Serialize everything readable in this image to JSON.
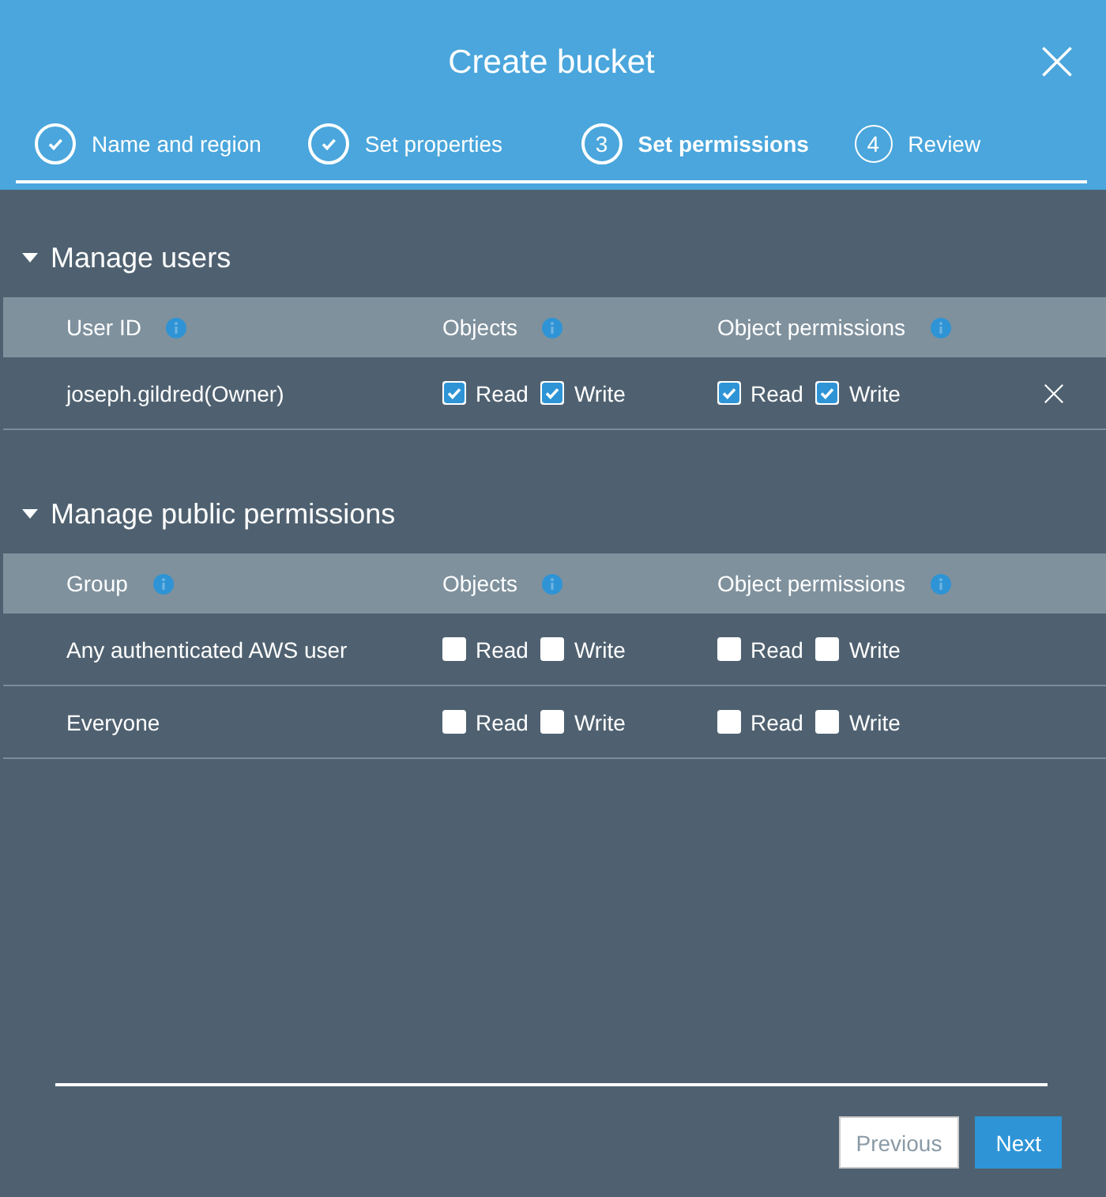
{
  "dialog": {
    "title": "Create bucket"
  },
  "steps": [
    {
      "label": "Name and region",
      "completed": true,
      "selected": false
    },
    {
      "label": "Set properties",
      "completed": true,
      "selected": false
    },
    {
      "label": "Set permissions",
      "completed": false,
      "selected": true,
      "number": "3"
    },
    {
      "label": "Review",
      "completed": false,
      "selected": false,
      "number": "4"
    }
  ],
  "sections": [
    {
      "title": "Manage users",
      "expanded": true,
      "columns": [
        "User ID",
        "Objects",
        "Object permissions"
      ],
      "rows": [
        {
          "name": "joseph.gildred(Owner)",
          "removable": true,
          "objects": [
            {
              "label": "Read",
              "checked": true
            },
            {
              "label": "Write",
              "checked": true
            }
          ],
          "object_permissions": [
            {
              "label": "Read",
              "checked": true
            },
            {
              "label": "Write",
              "checked": true
            }
          ]
        }
      ]
    },
    {
      "title": "Manage public permissions",
      "expanded": true,
      "columns": [
        "Group",
        "Objects",
        "Object permissions"
      ],
      "rows": [
        {
          "name": "Any authenticated AWS user",
          "removable": false,
          "objects": [
            {
              "label": "Read",
              "checked": false
            },
            {
              "label": "Write",
              "checked": false
            }
          ],
          "object_permissions": [
            {
              "label": "Read",
              "checked": false
            },
            {
              "label": "Write",
              "checked": false
            }
          ]
        },
        {
          "name": "Everyone",
          "removable": false,
          "objects": [
            {
              "label": "Read",
              "checked": false
            },
            {
              "label": "Write",
              "checked": false
            }
          ],
          "object_permissions": [
            {
              "label": "Read",
              "checked": false
            },
            {
              "label": "Write",
              "checked": false
            }
          ]
        }
      ]
    }
  ],
  "buttons": [
    {
      "label": "Previous",
      "kind": "secondary"
    },
    {
      "label": "Next",
      "kind": "primary"
    }
  ]
}
